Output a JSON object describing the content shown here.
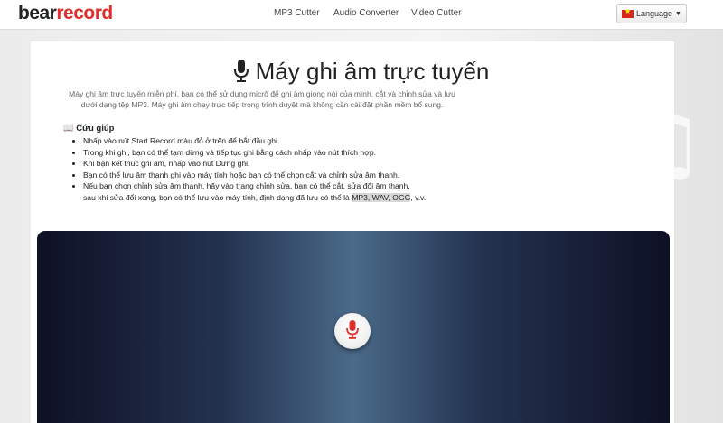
{
  "header": {
    "logo_part1": "bear",
    "logo_part2": "record",
    "nav": [
      "MP3 Cutter",
      "Audio Converter",
      "Video Cutter"
    ],
    "language_label": "Language"
  },
  "main": {
    "title": "Máy ghi âm trực tuyến",
    "intro_line1": "Máy ghi âm trực tuyến miễn phí, bạn có thể sử dụng micrô để ghi âm giọng nói của mình, cắt và chỉnh sửa và lưu",
    "intro_line2": "dưới dạng tệp MP3. Máy ghi âm chạy trực tiếp trong trình duyệt mà không cần cài đặt phần mềm bổ sung.",
    "help_title": "Cứu giúp",
    "help_items": [
      "Nhấp vào nút Start Record màu đỏ ở trên để bắt đầu ghi.",
      "Trong khi ghi, bạn có thể tạm dừng và tiếp tục ghi bằng cách nhấp vào nút thích hợp.",
      "Khi bạn kết thúc ghi âm, nhấp vào nút Dừng ghi.",
      "Bạn có thể lưu âm thanh ghi vào máy tính hoặc bạn có thể chọn cắt và chỉnh sửa âm thanh."
    ],
    "help_last_line1": "Nếu bạn chọn chỉnh sửa âm thanh, hãy vào trang chỉnh sửa, bạn có thể cắt, sửa đổi âm thanh,",
    "help_last_line2_a": "sau khi sửa đổi xong, bạn có thể lưu vào máy tính, định dạng đã lưu có thể là",
    "help_last_formats": "MP3, WAV, OGG",
    "help_last_line2_b": ", v.v."
  },
  "colors": {
    "accent": "#e0302b",
    "recorder_dark": "#0e1024",
    "recorder_light": "#4a6a89"
  },
  "icons": {
    "title": "microphone-icon",
    "help": "book-icon",
    "record": "microphone-icon",
    "flag": "vietnam-flag-icon"
  }
}
